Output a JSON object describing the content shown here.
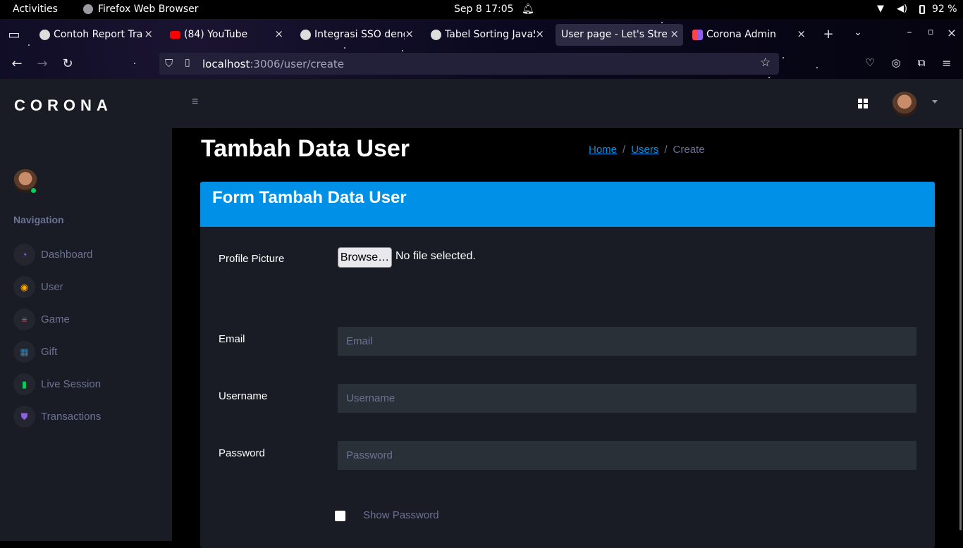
{
  "system": {
    "activities": "Activities",
    "app_name": "Firefox Web Browser",
    "datetime": "Sep 8  17:05",
    "battery": "92 %"
  },
  "browser": {
    "tabs": [
      {
        "label": "Contoh Report Tra",
        "active": false
      },
      {
        "label": "(84) YouTube",
        "active": false
      },
      {
        "label": "Integrasi SSO deng",
        "active": false
      },
      {
        "label": "Tabel Sorting JavaS",
        "active": false
      },
      {
        "label": "User page - Let's Strea",
        "active": true
      },
      {
        "label": "Corona Admin",
        "active": false
      }
    ],
    "url_host": "localhost",
    "url_path": ":3006/user/create"
  },
  "sidebar": {
    "brand": "CORONA",
    "nav_title": "Navigation",
    "items": [
      {
        "label": "Dashboard",
        "icon": "speedometer-icon",
        "color": "#8f5fe8"
      },
      {
        "label": "User",
        "icon": "user-circle-icon",
        "color": "#ffab00"
      },
      {
        "label": "Game",
        "icon": "playlist-icon",
        "color": "#fc424a"
      },
      {
        "label": "Gift",
        "icon": "table-icon",
        "color": "#0090e7"
      },
      {
        "label": "Live Session",
        "icon": "bar-chart-icon",
        "color": "#00d25b"
      },
      {
        "label": "Transactions",
        "icon": "shield-icon",
        "color": "#8f5fe8"
      }
    ]
  },
  "header": {
    "page_title": "Tambah Data User",
    "breadcrumb": {
      "home": "Home",
      "users": "Users",
      "current": "Create"
    }
  },
  "form": {
    "card_title": "Form Tambah Data User",
    "profile_label": "Profile Picture",
    "browse_label": "Browse…",
    "no_file": "No file selected.",
    "email_label": "Email",
    "email_placeholder": "Email",
    "username_label": "Username",
    "username_placeholder": "Username",
    "password_label": "Password",
    "password_placeholder": "Password",
    "show_password": "Show Password"
  },
  "colors": {
    "accent": "#0090e7",
    "sidebar_bg": "#191c24",
    "muted": "#6c7293",
    "online": "#00d25b"
  }
}
